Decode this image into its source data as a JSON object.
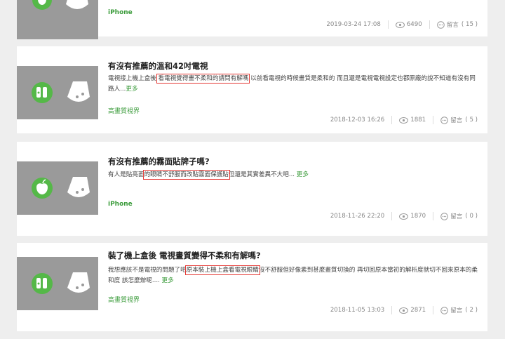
{
  "cards": [
    {
      "title": "",
      "excerpt": {
        "before": "",
        "highlight": "",
        "after": "",
        "more": ""
      },
      "category": "iPhone",
      "date": "2019-03-24 17:08",
      "views": "6490",
      "comments_label": "留言",
      "comments": "( 15 )",
      "icon": "apple-icon"
    },
    {
      "title": "有沒有推薦的溫和42吋電視",
      "excerpt": {
        "before": "電視接上機上盒後 ",
        "highlight": "看電視覺得畫不柔和的請問有解嗎",
        "after": " 以前看電視的時候畫質是柔和的 而且還是電視電視設定也都原廠的說不知道有沒有同路人...",
        "more": "更多"
      },
      "category": "高畫質視界",
      "date": "2018-12-03 16:26",
      "views": "1881",
      "comments_label": "留言",
      "comments": "( 5 )",
      "icon": "display-icon"
    },
    {
      "title": "有沒有推薦的霧面貼牌子嗎?",
      "excerpt": {
        "before": "有人是貼亮面",
        "highlight": "的眼睛不舒服而改貼霧面保護貼",
        "after": "但還是其實差異不大吧... ",
        "more": "更多"
      },
      "category": "iPhone",
      "date": "2018-11-26 22:20",
      "views": "1870",
      "comments_label": "留言",
      "comments": "( 0 )",
      "icon": "apple-icon"
    },
    {
      "title": "裝了機上盒後 電視畫質變得不柔和有解嗎?",
      "excerpt": {
        "before": "我想應該不是電視的問題了吧",
        "highlight": "原本裝上機上盒看電視眼睛",
        "after": "沒不舒服但好像素到甚麼畫質切換的 再切回原本當初的解析度就切不回來原本的柔和度 該怎麼辦呢.... ",
        "more": "更多"
      },
      "category": "高畫質視界",
      "date": "2018-11-05 13:03",
      "views": "2871",
      "comments_label": "留言",
      "comments": "( 2 )",
      "icon": "display-icon"
    }
  ]
}
